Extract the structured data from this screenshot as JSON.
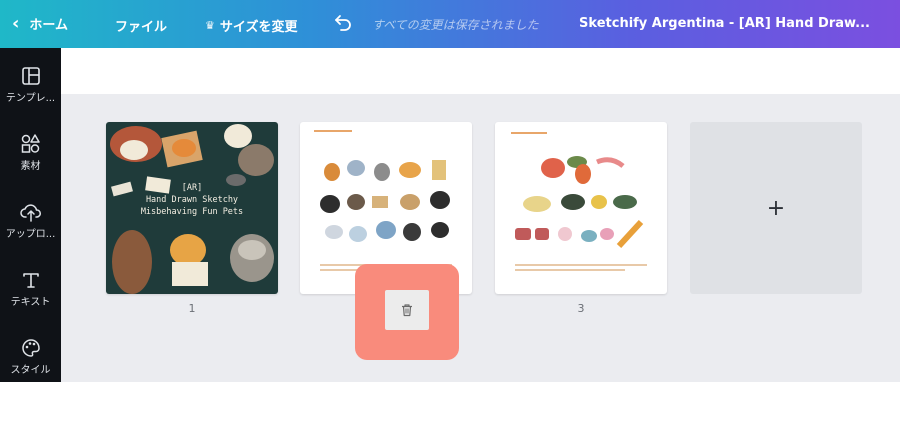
{
  "topbar": {
    "back_label": "ホーム",
    "file_label": "ファイル",
    "resize_label": "サイズを変更",
    "saved_status": "すべての変更は保存されました",
    "doc_title": "Sketchify Argentina - [AR] Hand Draw..."
  },
  "sidebar": {
    "items": [
      {
        "label": "テンプレ...",
        "icon": "template-icon"
      },
      {
        "label": "素材",
        "icon": "elements-icon"
      },
      {
        "label": "アップロ...",
        "icon": "upload-icon"
      },
      {
        "label": "テキスト",
        "icon": "text-icon"
      },
      {
        "label": "スタイル",
        "icon": "palette-icon"
      }
    ]
  },
  "pages": [
    {
      "number": "1",
      "cover_title": "[AR]",
      "cover_line2": "Hand Drawn Sketchy",
      "cover_line3": "Misbehaving Fun Pets"
    },
    {
      "number": ""
    },
    {
      "number": "3"
    }
  ],
  "add_page_symbol": "+",
  "colors": {
    "accent_delete": "#f98b7c",
    "cover_bg": "#1f3b3a",
    "sidebar_bg": "#0f1217",
    "canvas_bg": "#ebecf0"
  }
}
